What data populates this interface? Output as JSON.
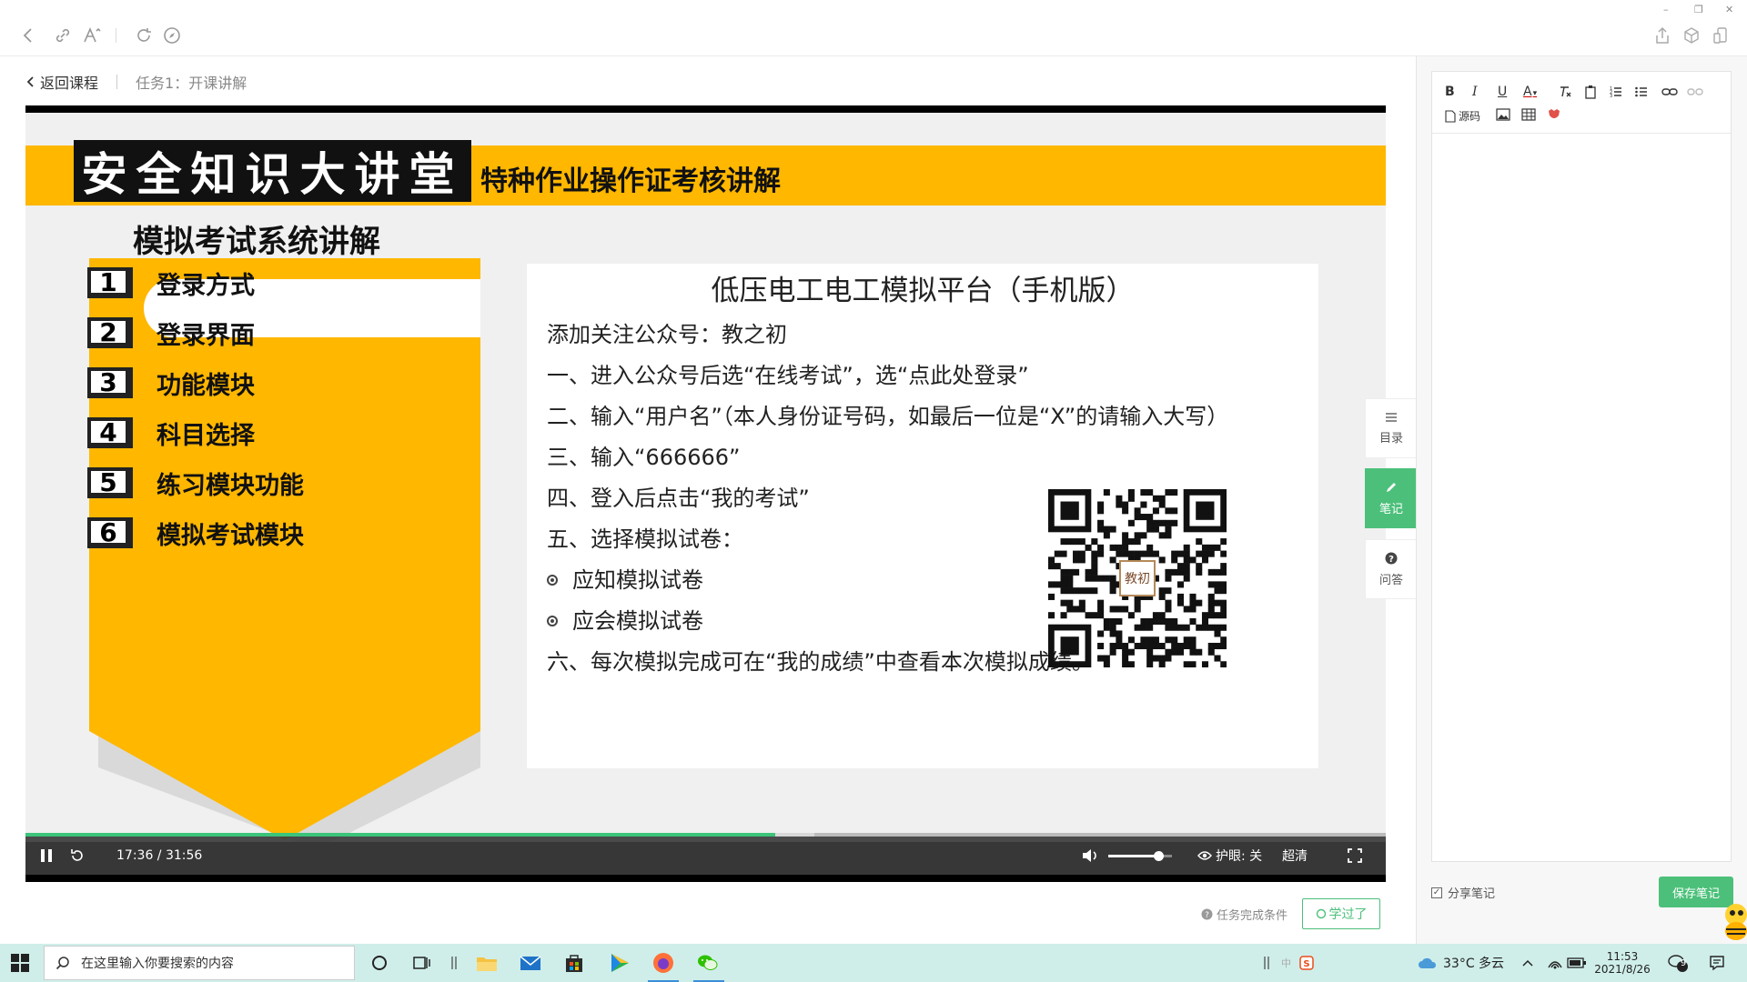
{
  "breadcrumb": {
    "back": "返回课程",
    "task": "任务1：开课讲解"
  },
  "slide": {
    "banner_main": "安全知识大讲堂",
    "banner_sub": "特种作业操作证考核讲解",
    "system_title": "模拟考试系统讲解",
    "menu": [
      {
        "num": "1",
        "label": "登录方式"
      },
      {
        "num": "2",
        "label": "登录界面"
      },
      {
        "num": "3",
        "label": "功能模块"
      },
      {
        "num": "4",
        "label": "科目选择"
      },
      {
        "num": "5",
        "label": "练习模块功能"
      },
      {
        "num": "6",
        "label": "模拟考试模块"
      }
    ],
    "panel_title": "低压电工电工模拟平台（手机版）",
    "lines": [
      "添加关注公众号：教之初",
      "一、进入公众号后选“在线考试”，选“点此处登录”",
      "二、输入“用户名”（本人身份证号码，如最后一位是“X”的请输入大写）",
      "三、输入“666666”",
      "四、登入后点击“我的考试”",
      "五、选择模拟试卷：",
      "应知模拟试卷",
      "应会模拟试卷",
      "六、每次模拟完成可在“我的成绩”中查看本次模拟成绩。"
    ],
    "qr_seal": "教初"
  },
  "player": {
    "time": "17:36 / 31:56",
    "progress": 0.551,
    "buffered": 0.58,
    "volume": 0.78,
    "eye_care": "护眼: 关",
    "quality": "超清"
  },
  "footer": {
    "condition": "任务完成条件",
    "learned": "学过了"
  },
  "side_tabs": [
    {
      "label": "目录",
      "icon": "list-icon"
    },
    {
      "label": "笔记",
      "icon": "pencil-icon"
    },
    {
      "label": "问答",
      "icon": "question-icon"
    }
  ],
  "notes": {
    "toolbar": {
      "bold": "B",
      "italic": "I",
      "underline": "U",
      "font_color": "A",
      "source": "源码"
    },
    "share": "分享笔记",
    "save": "保存笔记"
  },
  "taskbar": {
    "search_placeholder": "在这里输入你要搜索的内容",
    "weather": "33°C  多云",
    "time": "11:53",
    "date": "2021/8/26",
    "notification_count": "9",
    "lang": "中"
  },
  "colors": {
    "accent": "#4cc07a",
    "banner": "#ffb700",
    "taskbar": "#cfeee9"
  }
}
